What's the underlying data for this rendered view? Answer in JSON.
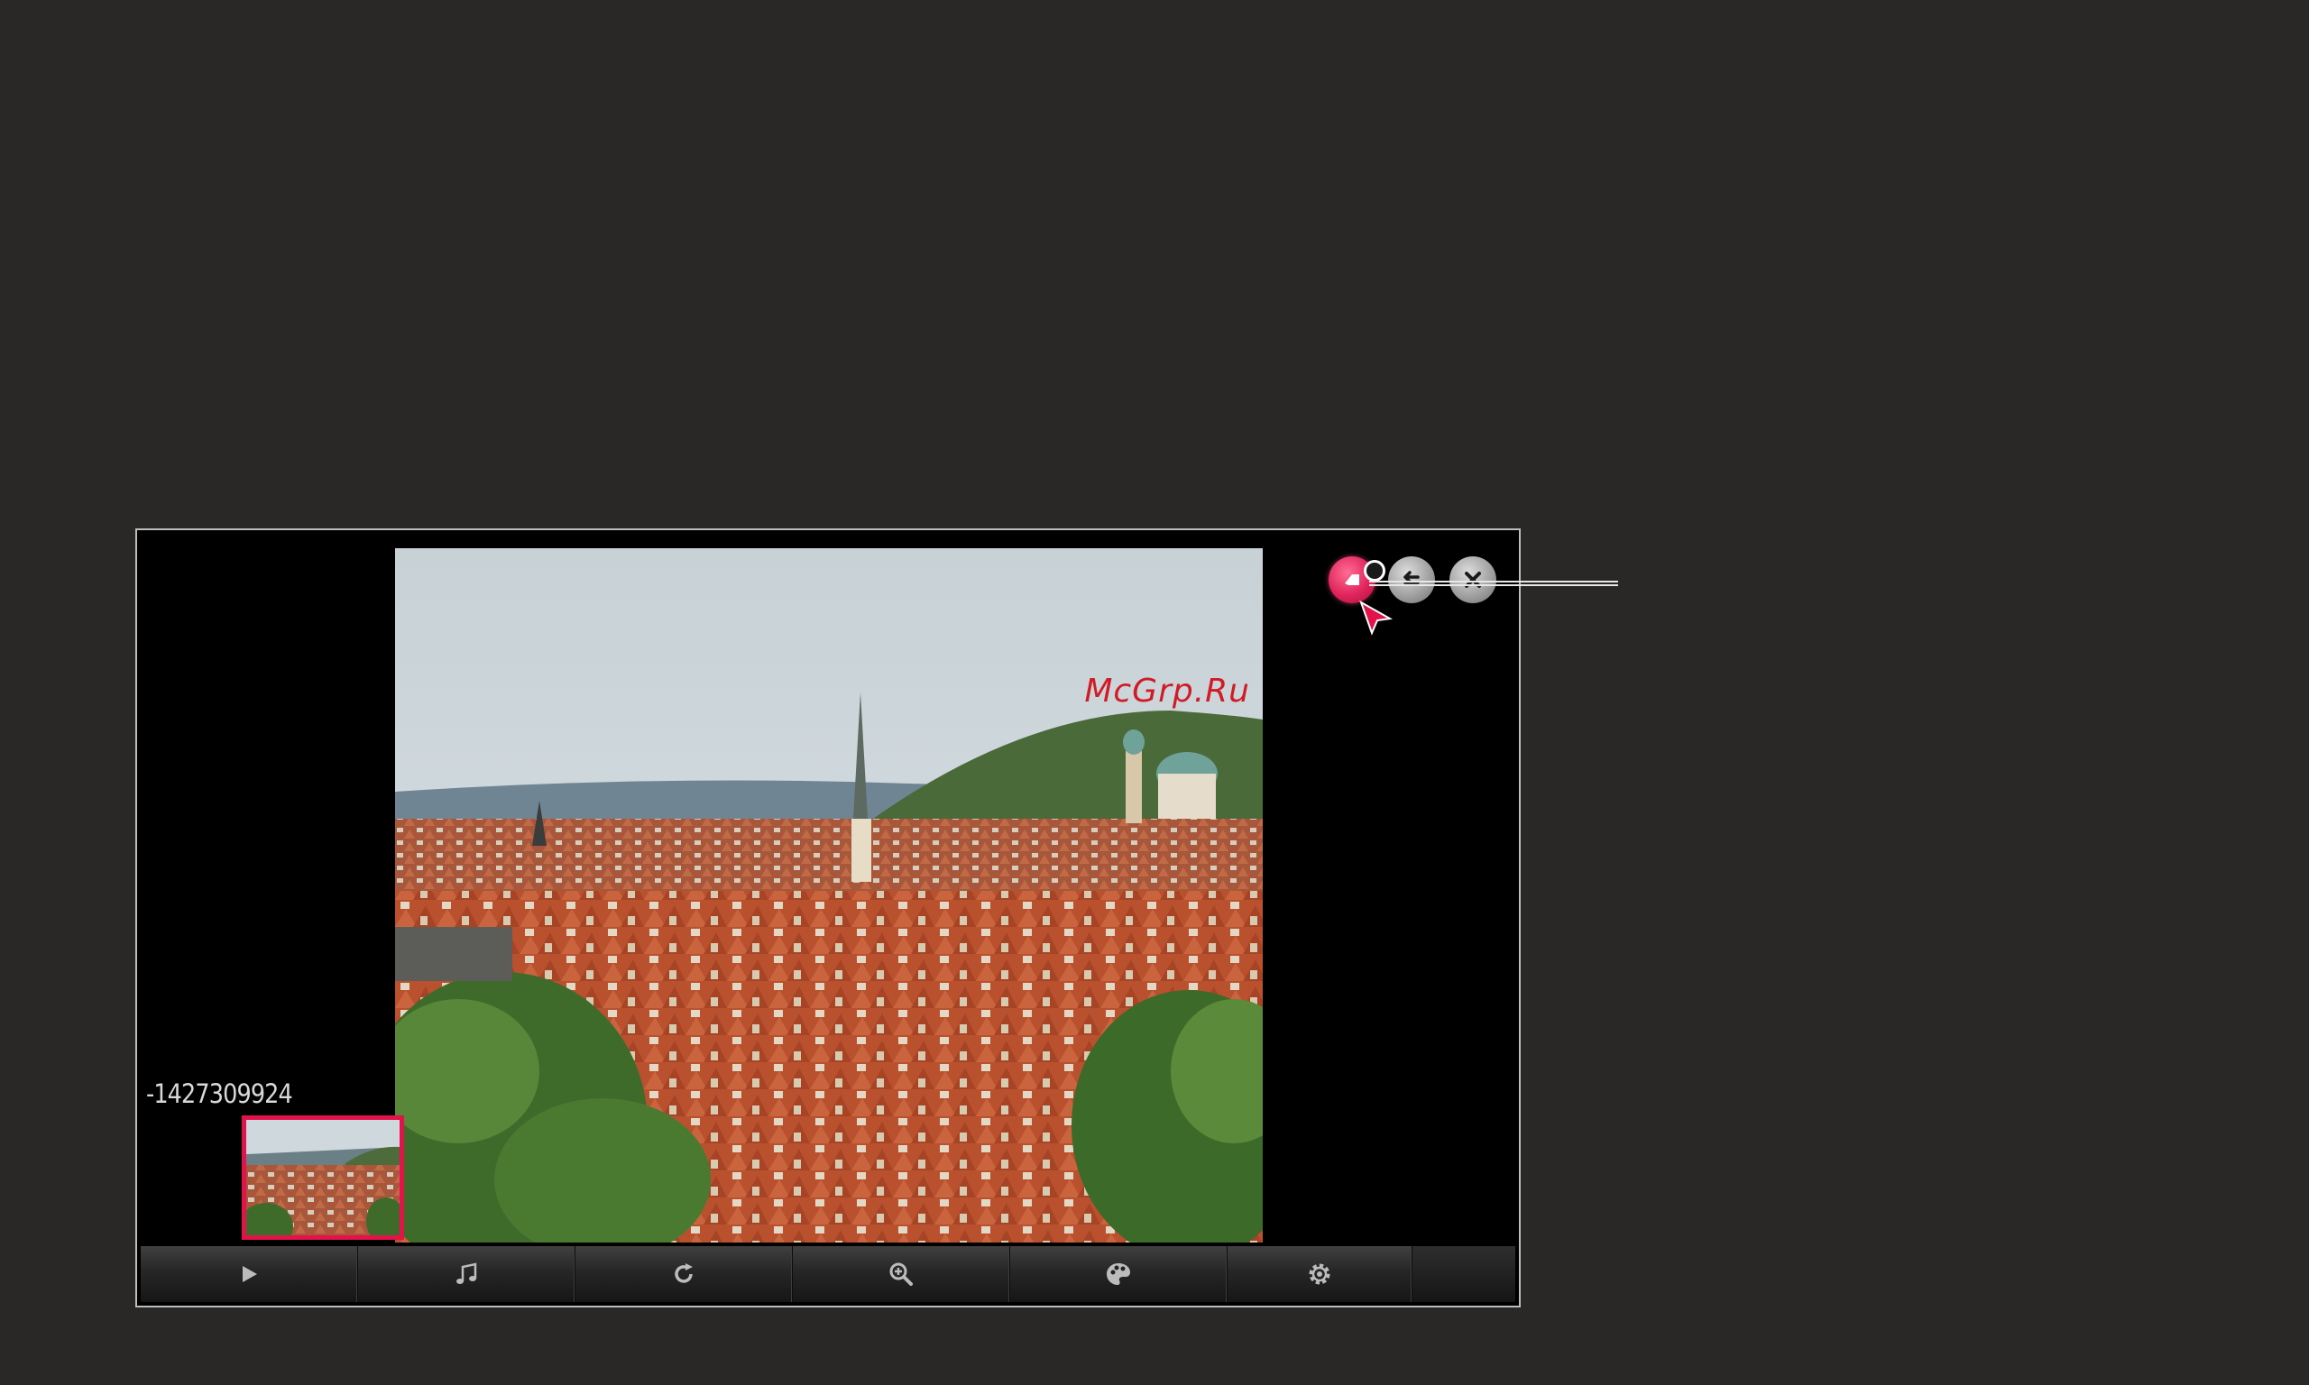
{
  "viewer": {
    "file_name": "-1427309924",
    "watermark": "McGrp.Ru"
  },
  "controls": {
    "pointer_icon": "pointer-icon",
    "return_icon": "return-icon",
    "exit_icon": "close-icon"
  },
  "toolbar": {
    "items": [
      {
        "name": "play",
        "icon": "play-icon"
      },
      {
        "name": "music",
        "icon": "music-note-icon"
      },
      {
        "name": "rotate",
        "icon": "rotate-icon"
      },
      {
        "name": "zoom",
        "icon": "zoom-in-icon"
      },
      {
        "name": "picture-mode",
        "icon": "palette-icon"
      },
      {
        "name": "settings",
        "icon": "gear-icon"
      }
    ]
  },
  "colors": {
    "background": "#2a2727",
    "accent": "#e2124a",
    "watermark": "#d01c26"
  }
}
